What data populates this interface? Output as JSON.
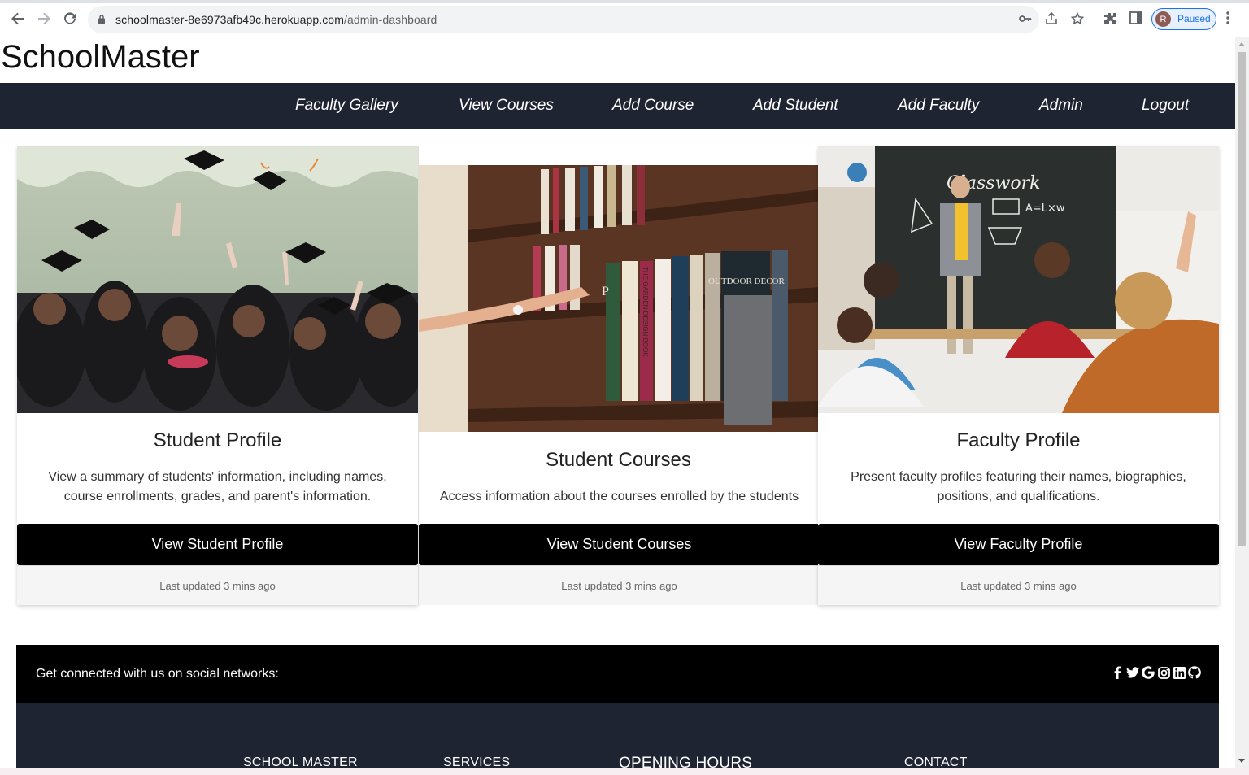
{
  "browser": {
    "url_host": "schoolmaster-8e6973afb49c.herokuapp.com",
    "url_path": "/admin-dashboard",
    "profile_initial": "R",
    "profile_status": "Paused"
  },
  "site": {
    "brand": "SchoolMaster"
  },
  "nav": {
    "items": [
      "Faculty Gallery",
      "View Courses",
      "Add Course",
      "Add Student",
      "Add Faculty",
      "Admin",
      "Logout"
    ]
  },
  "cards": [
    {
      "title": "Student Profile",
      "description": "View a summary of students' information, including names, course enrollments, grades, and parent's information.",
      "button": "View Student Profile",
      "footer": "Last updated 3 mins ago",
      "image": "graduation-caps-photo"
    },
    {
      "title": "Student Courses",
      "description": "Access information about the courses enrolled by the students",
      "button": "View Student Courses",
      "footer": "Last updated 3 mins ago",
      "image": "library-bookshelf-photo",
      "image_text": {
        "title": "OUTDOOR DECOR",
        "spine": "THE GARDEN DESIGN BOOK",
        "letter": "P"
      }
    },
    {
      "title": "Faculty Profile",
      "description": "Present faculty profiles featuring their names, biographies, positions, and qualifications.",
      "button": "View Faculty Profile",
      "footer": "Last updated 3 mins ago",
      "image": "classroom-photo",
      "image_text": {
        "board_title": "Classwork",
        "formula": "A=L×w"
      }
    }
  ],
  "footer": {
    "social_text": "Get connected with us on social networks:",
    "social_icons": [
      "facebook-icon",
      "twitter-icon",
      "google-icon",
      "instagram-icon",
      "linkedin-icon",
      "github-icon"
    ],
    "columns": [
      "SCHOOL MASTER",
      "SERVICES",
      "OPENING HOURS",
      "CONTACT"
    ]
  },
  "colors": {
    "navbar_bg": "#1f2433",
    "button_bg": "#000000",
    "footer_bg": "#1f2433",
    "social_bg": "#000000"
  }
}
